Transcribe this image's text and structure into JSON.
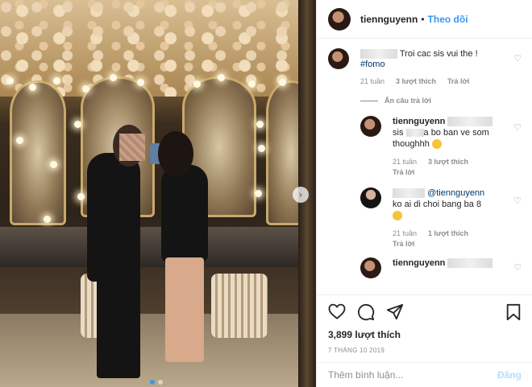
{
  "post": {
    "username": "tiennguyenn",
    "follow_label": "Theo dõi",
    "separator": "•"
  },
  "comments": [
    {
      "text": "Troi cac sis vui the !",
      "hashtag": "#fomo",
      "time": "21 tuần",
      "likes": "3 lượt thích",
      "reply_label": "Trả lời"
    }
  ],
  "hide_replies_label": "Ẩn câu trả lời",
  "replies": [
    {
      "username": "tiennguyenn",
      "text_prefix": "sis",
      "text": "a bo ban ve som thoughhh",
      "time": "21 tuần",
      "likes": "3 lượt thích",
      "reply_label": "Trả lời"
    },
    {
      "mention": "@tiennguyenn",
      "text": "ko ai di choi bang ba 8",
      "time": "21 tuần",
      "likes": "1 lượt thích",
      "reply_label": "Trả lời"
    },
    {
      "username": "tiennguyenn"
    }
  ],
  "actions": {
    "icons": [
      "heart-icon",
      "comment-icon",
      "share-icon",
      "save-icon"
    ],
    "likes_count": "3,899 lượt thích",
    "date": "7 THÁNG 10 2019"
  },
  "add_comment": {
    "placeholder": "Thêm bình luận...",
    "post_label": "Đăng"
  },
  "carousel": {
    "slides": 2,
    "active_slide": 1
  },
  "colors": {
    "link": "#3897f0",
    "hashtag": "#00376b",
    "muted": "#8e8e8e"
  }
}
